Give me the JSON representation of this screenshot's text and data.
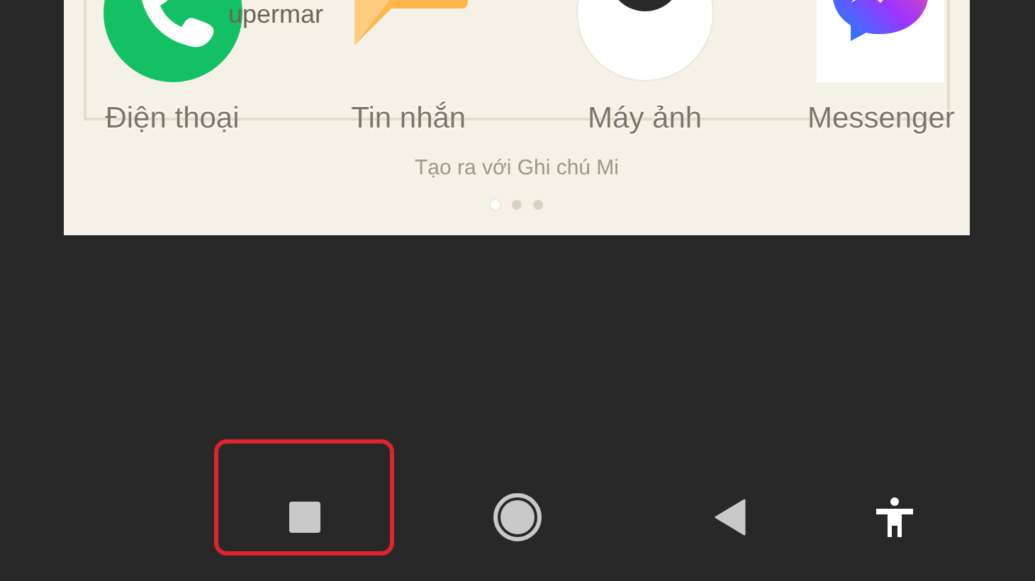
{
  "widget": {
    "heading": "upermar",
    "apps": [
      {
        "kind": "phone",
        "label": "Điện thoại"
      },
      {
        "kind": "messages",
        "label": "Tin nhắn"
      },
      {
        "kind": "camera",
        "label": "Máy ảnh"
      },
      {
        "kind": "messenger",
        "label": "Messenger"
      }
    ],
    "caption": "Tạo ra với Ghi chú Mi",
    "pages": [
      {
        "selected": true
      },
      {
        "selected": false
      },
      {
        "selected": false
      }
    ]
  },
  "nav_bar": {
    "buttons": [
      {
        "kind": "recents",
        "highlighted": true
      },
      {
        "kind": "home",
        "highlighted": false
      },
      {
        "kind": "back",
        "highlighted": false
      },
      {
        "kind": "accessibility",
        "highlighted": false
      }
    ]
  }
}
